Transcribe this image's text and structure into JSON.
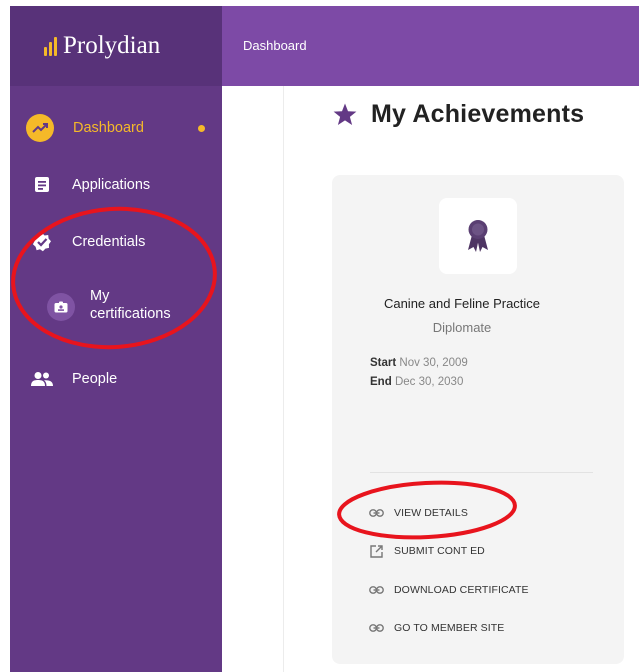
{
  "brand": {
    "name": "Prolydian",
    "logo_color": "#f5b929"
  },
  "header": {
    "breadcrumb": "Dashboard"
  },
  "sidebar": {
    "items": [
      {
        "label": "Dashboard",
        "icon": "trending-icon",
        "active": true,
        "active_color": "#f5b929"
      },
      {
        "label": "Applications",
        "icon": "document-icon"
      },
      {
        "label": "Credentials",
        "icon": "verified-badge-icon"
      },
      {
        "label": "My\ncertifications",
        "icon": "id-badge-icon"
      },
      {
        "label": "People",
        "icon": "people-icon"
      }
    ]
  },
  "page": {
    "title": "My Achievements",
    "title_icon": "star-icon"
  },
  "card": {
    "badge_icon": "award-ribbon-icon",
    "title": "Canine and Feline Practice",
    "subtitle": "Diplomate",
    "start_label": "Start",
    "start_value": "Nov 30, 2009",
    "end_label": "End",
    "end_value": "Dec 30, 2030",
    "actions": [
      {
        "label": "VIEW DETAILS",
        "icon": "link-icon"
      },
      {
        "label": "SUBMIT CONT ED",
        "icon": "external-link-icon"
      },
      {
        "label": "DOWNLOAD CERTIFICATE",
        "icon": "link-icon"
      },
      {
        "label": "GO TO MEMBER SITE",
        "icon": "link-icon"
      }
    ]
  },
  "colors": {
    "sidebar": "#633985",
    "header": "#7d4aa6",
    "accent": "#f5b929",
    "annotation": "#e8141d"
  }
}
